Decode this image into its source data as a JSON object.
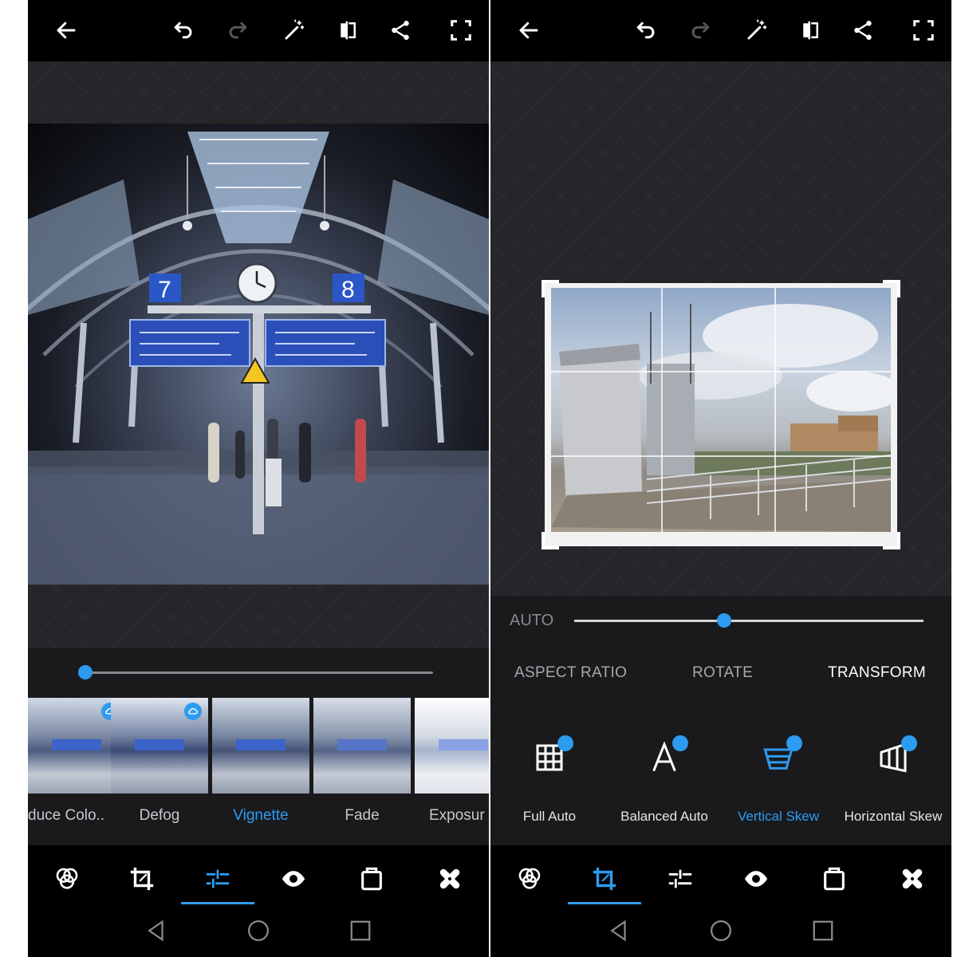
{
  "left": {
    "top_icons": [
      "back-icon",
      "undo-icon",
      "redo-icon",
      "magic-wand-icon",
      "compare-icon",
      "share-icon",
      "fullscreen-icon"
    ],
    "slider_value": 0.0,
    "filters": [
      {
        "label": "duce Colo..",
        "badge": true
      },
      {
        "label": "Defog",
        "badge": true
      },
      {
        "label": "Vignette",
        "badge": false,
        "active": true
      },
      {
        "label": "Fade",
        "badge": false
      },
      {
        "label": "Exposur",
        "badge": false
      }
    ],
    "sign_left": "7",
    "sign_right": "8",
    "bottom_tools": [
      "looks-icon",
      "crop-icon",
      "adjust-sliders-icon",
      "eye-icon",
      "frame-icon",
      "heal-icon"
    ],
    "bottom_active": "adjust-sliders-icon"
  },
  "right": {
    "top_icons": [
      "back-icon",
      "undo-icon",
      "redo-icon",
      "magic-wand-icon",
      "compare-icon",
      "share-icon",
      "fullscreen-icon"
    ],
    "auto_label": "AUTO",
    "slider_value": 0.43,
    "tabs": [
      {
        "label": "ASPECT RATIO",
        "active": false
      },
      {
        "label": "ROTATE",
        "active": false
      },
      {
        "label": "TRANSFORM",
        "active": true
      }
    ],
    "tools": [
      {
        "label": "Full Auto",
        "icon": "grid-icon",
        "active": false
      },
      {
        "label": "Balanced Auto",
        "icon": "letter-a-icon",
        "active": false
      },
      {
        "label": "Vertical Skew",
        "icon": "vertical-skew-icon",
        "active": true
      },
      {
        "label": "Horizontal Skew",
        "icon": "horizontal-skew-icon",
        "active": false
      }
    ],
    "bottom_tools": [
      "looks-icon",
      "crop-icon",
      "adjust-sliders-icon",
      "eye-icon",
      "frame-icon",
      "heal-icon"
    ],
    "bottom_active": "crop-icon"
  },
  "colors": {
    "accent": "#2d9bf0",
    "toolbar_bg": "#000000",
    "panel_bg": "#1f1f23"
  }
}
